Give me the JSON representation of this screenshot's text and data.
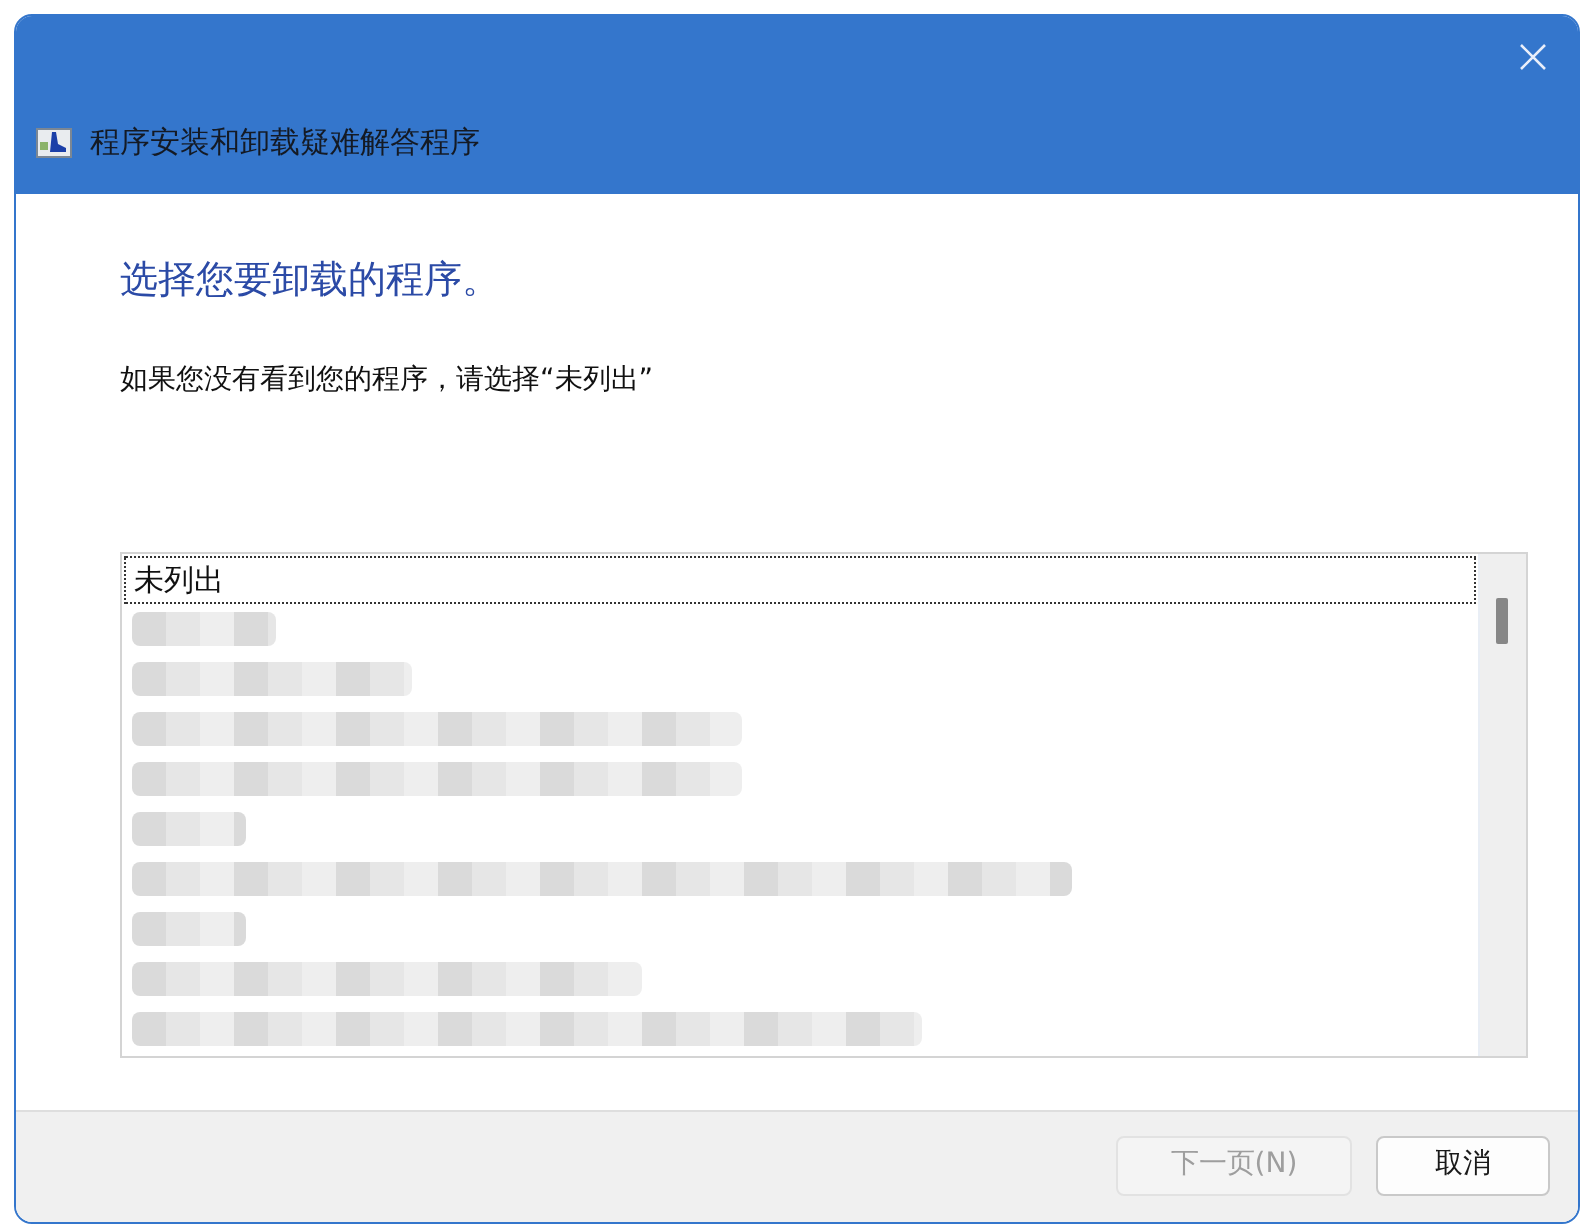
{
  "window": {
    "title": "程序安装和卸载疑难解答程序"
  },
  "heading": "选择您要卸载的程序。",
  "instruction": "如果您没有看到您的程序，请选择“未列出”",
  "program_list": {
    "items": [
      {
        "kind": "entry",
        "label": "未列出",
        "focused": true
      },
      {
        "kind": "blurred",
        "focused": false
      },
      {
        "kind": "blurred",
        "focused": false
      },
      {
        "kind": "blurred",
        "focused": false
      },
      {
        "kind": "blurred",
        "focused": false
      },
      {
        "kind": "blurred",
        "focused": false
      },
      {
        "kind": "blurred",
        "focused": false
      },
      {
        "kind": "blurred",
        "focused": false
      },
      {
        "kind": "blurred",
        "focused": false
      },
      {
        "kind": "blurred",
        "focused": false
      }
    ]
  },
  "buttons": [
    {
      "label": "下一页(N)",
      "disabled": true
    },
    {
      "label": "取消",
      "disabled": false
    }
  ]
}
